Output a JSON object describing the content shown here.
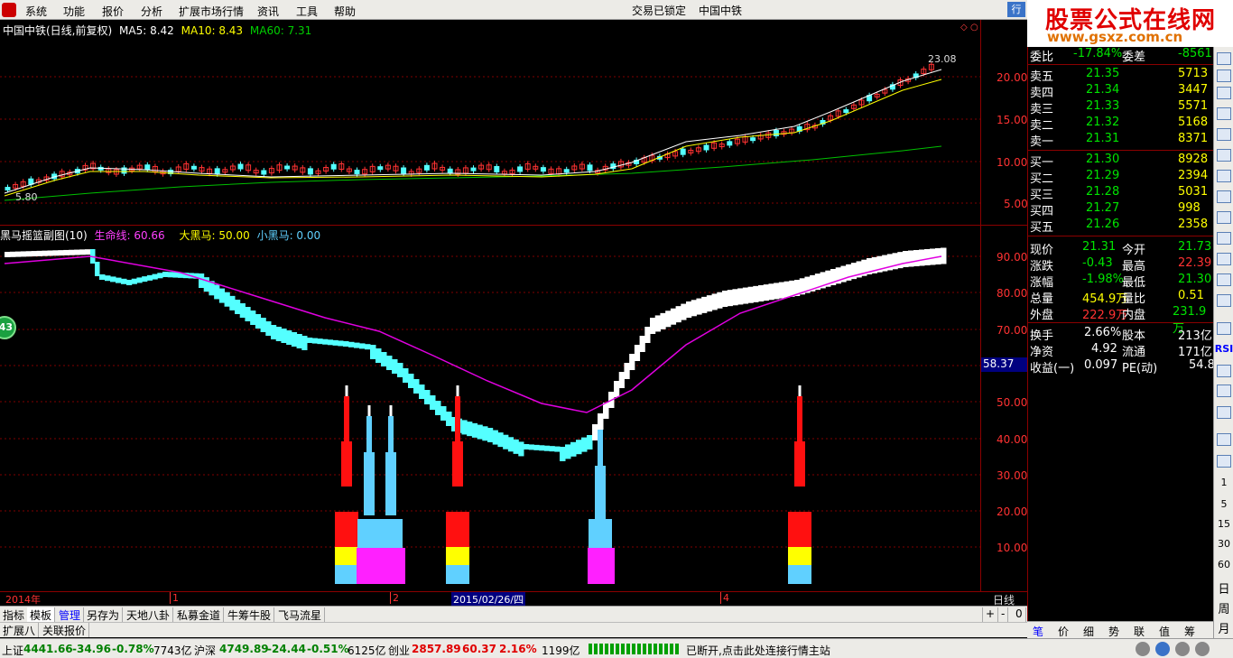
{
  "menu": {
    "items": [
      "系统",
      "功能",
      "报价",
      "分析",
      "扩展市场行情",
      "资讯",
      "工具",
      "帮助"
    ],
    "center_status": "交易已锁定",
    "center_stock": "中国中铁",
    "right_btn": "行"
  },
  "brand": {
    "title": "股票公式在线网",
    "url": "www.gsxz.com.cn"
  },
  "main_chart": {
    "title": "中国中铁(日线,前复权)",
    "ma5": "MA5: 8.42",
    "ma10": "MA10: 8.43",
    "ma60": "MA60: 7.31",
    "high_label": "23.08",
    "low_label": "5.80",
    "y_ticks": [
      "20.00",
      "15.00",
      "10.00",
      "5.00"
    ],
    "ma5_color": "#ffffff",
    "ma10_color": "#ffff00",
    "ma60_color": "#00c000"
  },
  "sub_chart": {
    "title": "黑马摇篮副图(10)",
    "life_line": "生命线: 60.66",
    "big_horse": "大黑马: 50.00",
    "small_horse": "小黑马: 0.00",
    "current_label": "58.37",
    "y_ticks": [
      "90.00",
      "80.00",
      "70.00",
      "60.00",
      "50.00",
      "40.00",
      "30.00",
      "20.00",
      "10.00"
    ],
    "life_color": "#e000e0",
    "big_color": "#ffff00",
    "small_color": "#60d0ff"
  },
  "side_badge": "43",
  "time_axis": {
    "labels": [
      "2014年",
      "1",
      "2",
      "2015/02/26/四",
      "4"
    ],
    "period": "日线"
  },
  "tabs_row1": [
    "指标",
    "模板",
    "管理",
    "另存为",
    "天地八卦",
    "私募金道",
    "牛筹牛股",
    "飞马流星"
  ],
  "tabs_row1_controls": [
    "+",
    "-",
    "0"
  ],
  "tabs_row2": [
    "扩展八",
    "关联报价"
  ],
  "quote": {
    "ratio_row": {
      "label": "委比",
      "value": "-17.84%",
      "label2": "委差",
      "value2": "-8561"
    },
    "sells": [
      {
        "label": "卖五",
        "price": "21.35",
        "vol": "5713"
      },
      {
        "label": "卖四",
        "price": "21.34",
        "vol": "3447"
      },
      {
        "label": "卖三",
        "price": "21.33",
        "vol": "5571"
      },
      {
        "label": "卖二",
        "price": "21.32",
        "vol": "5168"
      },
      {
        "label": "卖一",
        "price": "21.31",
        "vol": "8371"
      }
    ],
    "buys": [
      {
        "label": "买一",
        "price": "21.30",
        "vol": "8928"
      },
      {
        "label": "买二",
        "price": "21.29",
        "vol": "2394"
      },
      {
        "label": "买三",
        "price": "21.28",
        "vol": "5031"
      },
      {
        "label": "买四",
        "price": "21.27",
        "vol": "998"
      },
      {
        "label": "买五",
        "price": "21.26",
        "vol": "2358"
      }
    ],
    "stats": [
      {
        "l1": "现价",
        "v1": "21.31",
        "l2": "今开",
        "v2": "21.73"
      },
      {
        "l1": "涨跌",
        "v1": "-0.43",
        "l2": "最高",
        "v2": "22.39"
      },
      {
        "l1": "涨幅",
        "v1": "-1.98%",
        "l2": "最低",
        "v2": "21.30"
      },
      {
        "l1": "总量",
        "v1": "454.9万",
        "l2": "量比",
        "v2": "0.51"
      },
      {
        "l1": "外盘",
        "v1": "222.9万",
        "l2": "内盘",
        "v2": "231.9万"
      },
      {
        "l1": "换手",
        "v1": "2.66%",
        "l2": "股本",
        "v2": "213亿"
      },
      {
        "l1": "净资",
        "v1": "4.92",
        "l2": "流通",
        "v2": "171亿"
      },
      {
        "l1": "收益(一)",
        "v1": "0.097",
        "l2": "PE(动)",
        "v2": "54.8"
      }
    ]
  },
  "right_tabs": [
    "笔",
    "价",
    "细",
    "势",
    "联",
    "值",
    "筹"
  ],
  "right_toolbar_nums": [
    "RSI",
    "1",
    "5",
    "15",
    "30",
    "60",
    "日",
    "周",
    "月"
  ],
  "status": {
    "sh_label": "上证",
    "sh_val": "4441.66",
    "sh_chg": "-34.96",
    "sh_pct": "-0.78%",
    "sh_amt": "7743亿",
    "sz_label": "沪深",
    "sz_val": "4749.89",
    "sz_chg": "-24.44",
    "sz_pct": "-0.51%",
    "sz_amt": "6125亿",
    "cy_label": "创业",
    "cy_val": "2857.89",
    "cy_chg": "60.37",
    "cy_pct": "2.16%",
    "cy_amt": "1199亿",
    "message": "已断开,点击此处连接行情主站"
  }
}
